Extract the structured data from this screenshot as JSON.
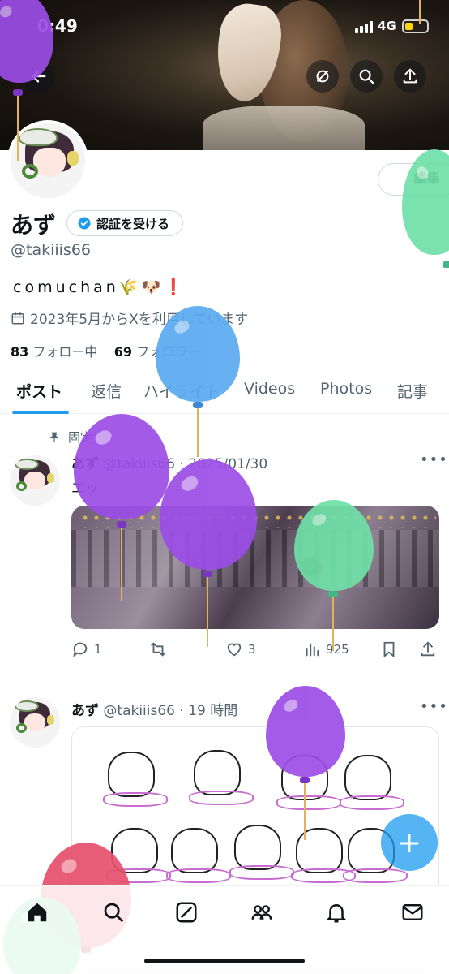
{
  "status_bar": {
    "time": "0:49",
    "network": "4G"
  },
  "header": {
    "back_icon": "arrow-left-icon",
    "actions": [
      "refresh-icon",
      "search-icon",
      "share-icon"
    ]
  },
  "profile": {
    "edit_label": "編集",
    "name": "あず",
    "verify_label": "認証を受ける",
    "handle": "@takiiis66",
    "bio": "comuchan🌾🐶❗",
    "joined": "2023年5月からXを利用しています",
    "following_count": "83",
    "following_label": "フォロー中",
    "followers_count": "69",
    "followers_label": "フォロワー"
  },
  "tabs": [
    {
      "label": "ポスト",
      "active": true
    },
    {
      "label": "返信"
    },
    {
      "label": "ハイライト"
    },
    {
      "label": "Videos"
    },
    {
      "label": "Photos"
    },
    {
      "label": "記事"
    }
  ],
  "posts": [
    {
      "pinned_label": "固定",
      "name": "あず",
      "meta": "@takiiis66 · 2025/01/30",
      "text": "エッ",
      "replies": "1",
      "likes": "3",
      "views": "925"
    },
    {
      "name": "あず",
      "meta": "@takiiis66 · 19 時間"
    }
  ],
  "colors": {
    "accent": "#1d9bf0",
    "balloon_purple": "#9b4de6",
    "balloon_blue": "#5aa9f0",
    "balloon_green": "#6fe0a8",
    "balloon_pink": "#e5506c"
  },
  "bottom_nav": [
    "home-icon",
    "search-icon",
    "grok-icon",
    "communities-icon",
    "notifications-icon",
    "messages-icon"
  ]
}
